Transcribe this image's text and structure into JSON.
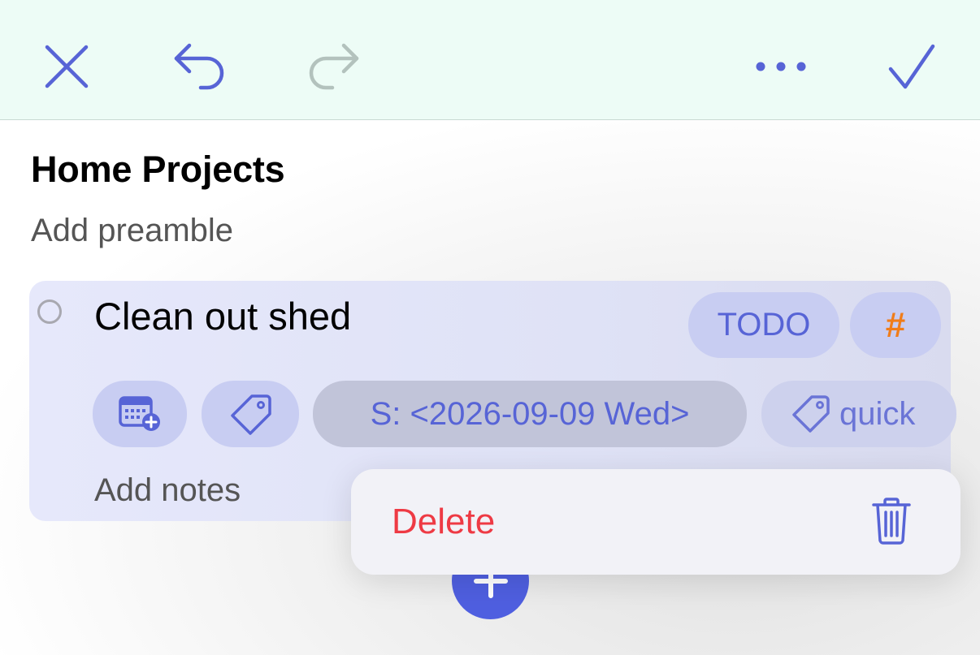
{
  "toolbar": {
    "close_icon": "close-icon",
    "undo_icon": "undo-icon",
    "redo_icon": "redo-icon",
    "more_icon": "more-icon",
    "done_icon": "checkmark-icon"
  },
  "document": {
    "title": "Home Projects",
    "preamble_placeholder": "Add preamble"
  },
  "task": {
    "title": "Clean out shed",
    "state_badge": "TODO",
    "priority_badge": "#",
    "schedule_chip": "S: <2026-09-09 Wed>",
    "tag_chip": "quick",
    "notes_placeholder": "Add notes"
  },
  "context_menu": {
    "delete_label": "Delete"
  },
  "colors": {
    "accent": "#5764d6",
    "toolbar_bg": "#edfcf6",
    "delete": "#ee3a44",
    "priority": "#f07d1a",
    "fab": "#4f5fe0"
  }
}
